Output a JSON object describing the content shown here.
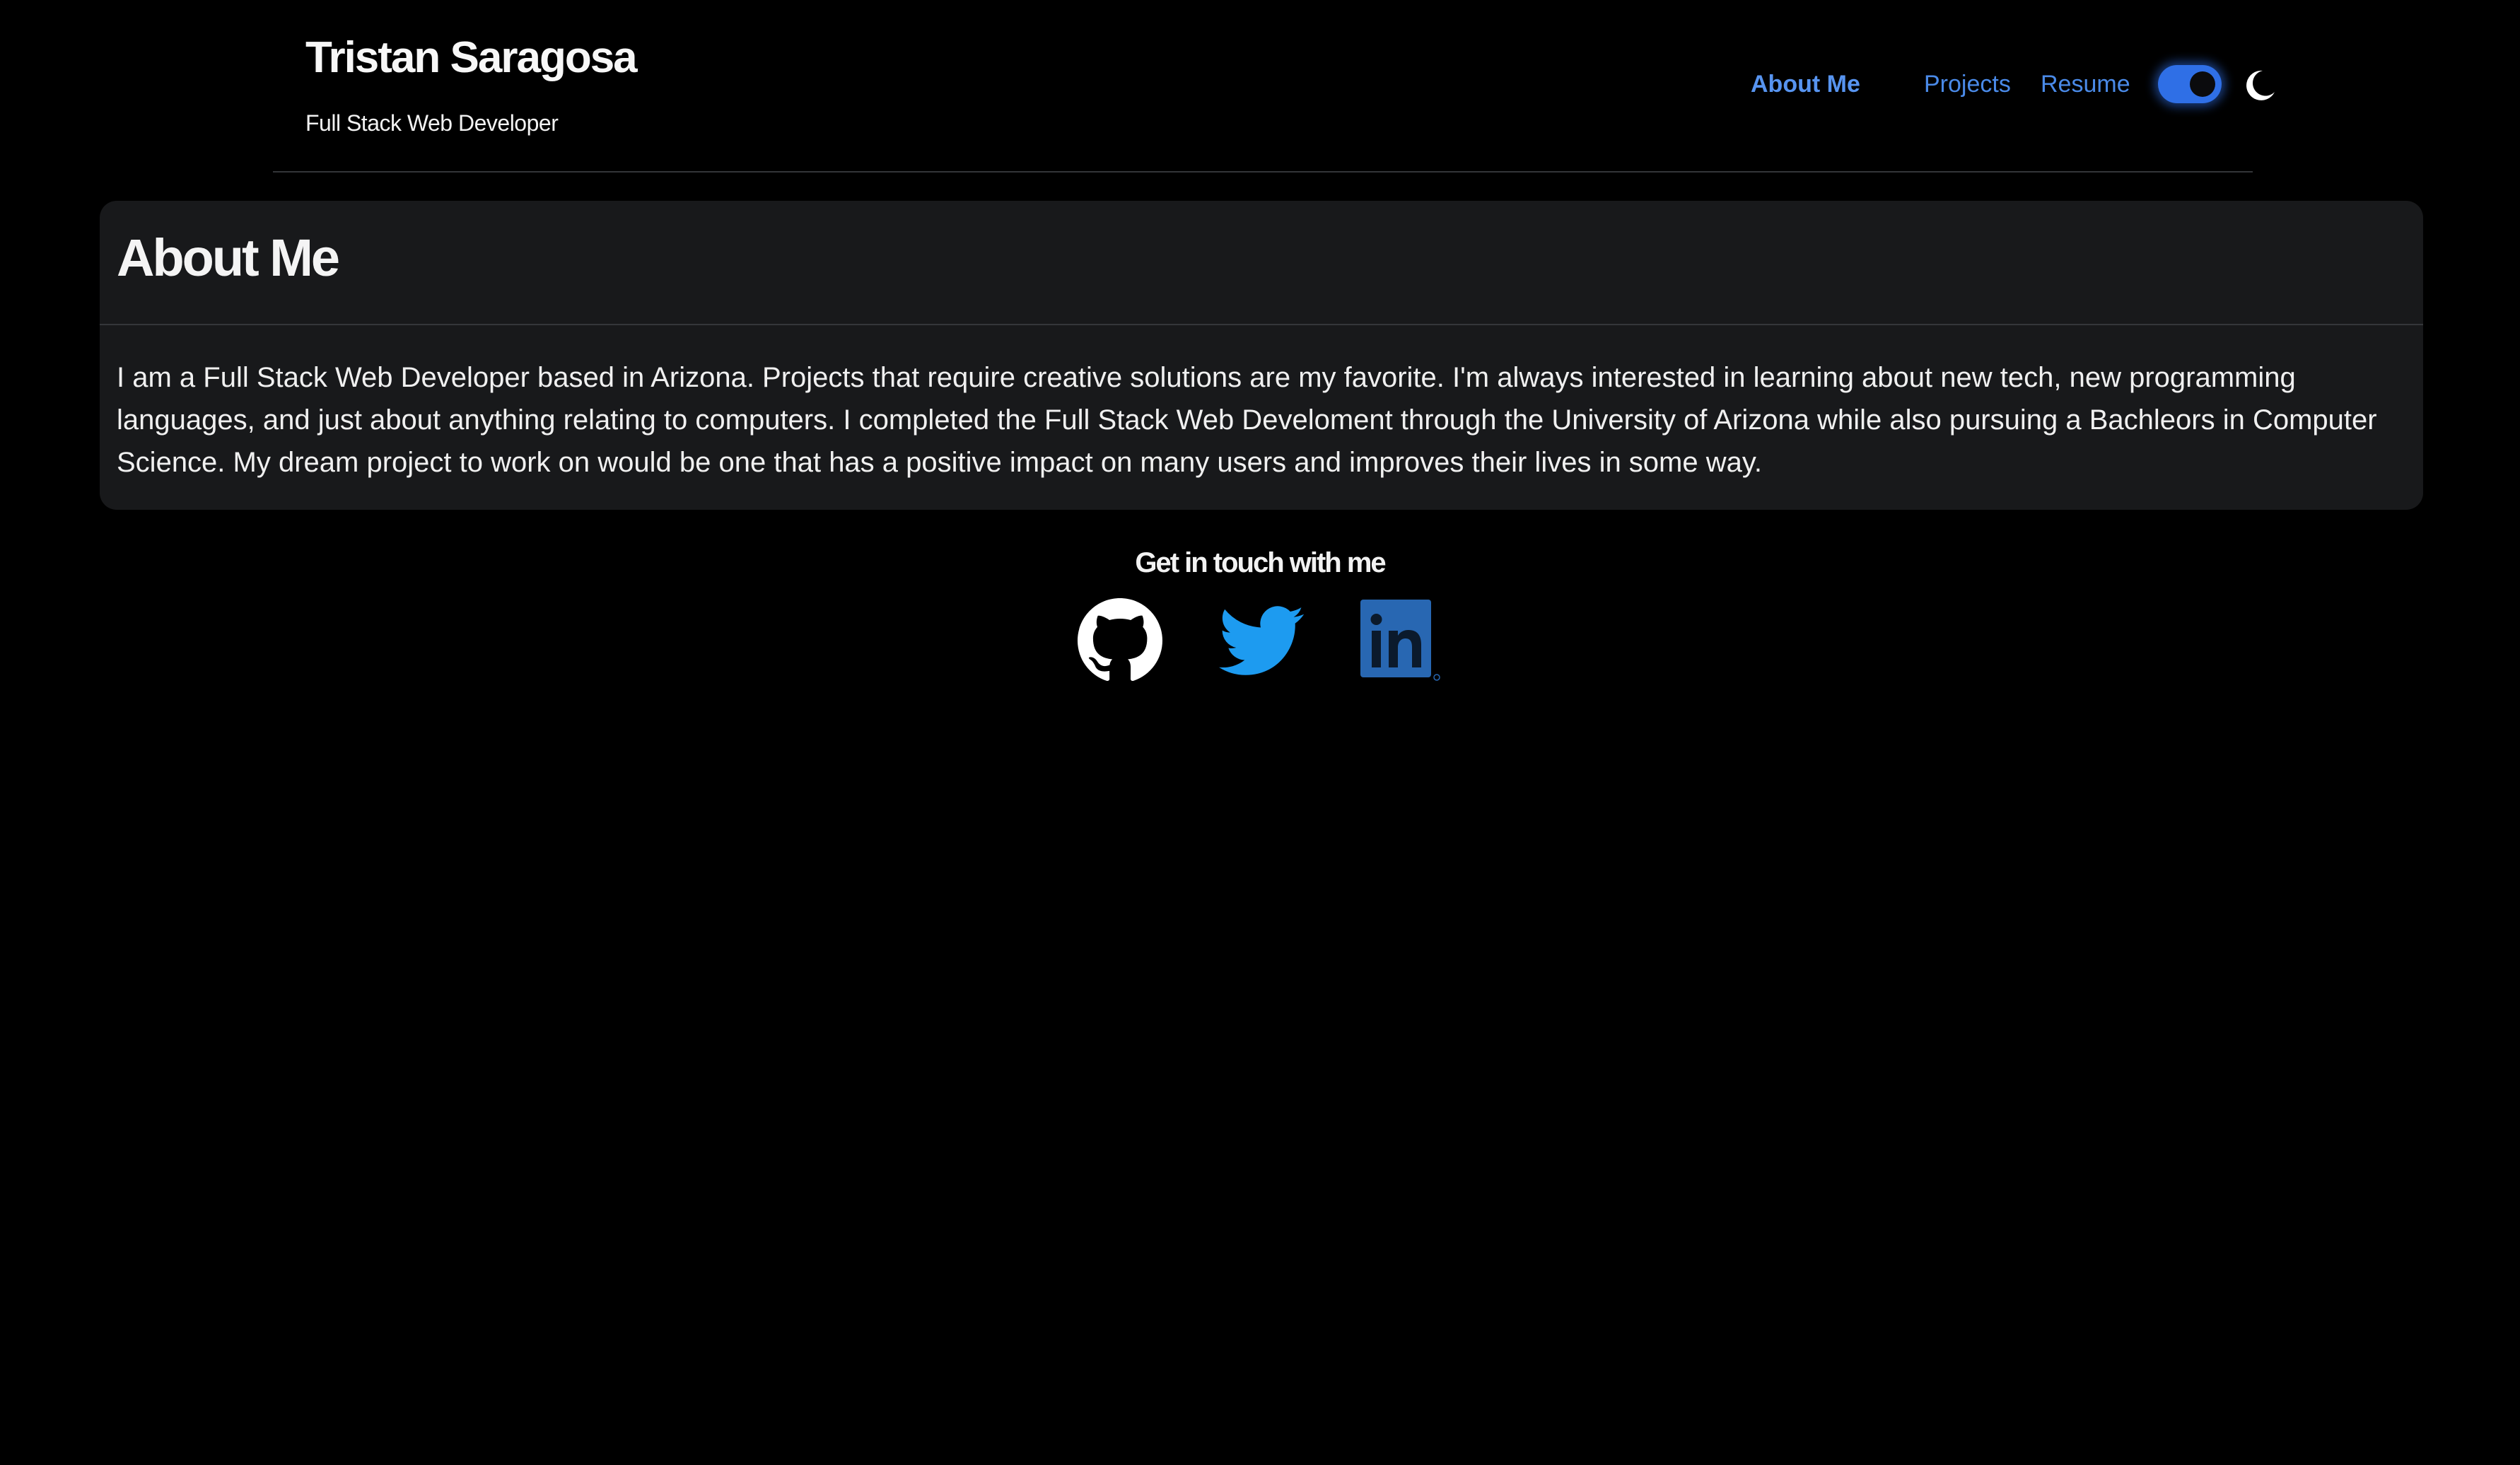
{
  "header": {
    "title": "Tristan Saragosa",
    "subtitle": "Full Stack Web Developer"
  },
  "nav": {
    "items": [
      {
        "label": "About Me",
        "active": true
      },
      {
        "label": "Projects",
        "active": false
      },
      {
        "label": "Resume",
        "active": false
      }
    ],
    "theme_toggle": {
      "state": "on",
      "icon": "moon-icon"
    }
  },
  "about": {
    "heading": "About Me",
    "body": "I am a Full Stack Web Developer based in Arizona. Projects that require creative solutions are my favorite. I'm always interested in learning about new tech, new programming languages, and just about anything relating to computers. I completed the Full Stack Web Develoment through the University of Arizona while also pursuing a Bachleors in Computer Science. My dream project to work on would be one that has a positive impact on many users and improves their lives in some way."
  },
  "contact": {
    "heading": "Get in touch with me",
    "links": [
      {
        "icon": "github-icon",
        "color": "#ffffff"
      },
      {
        "icon": "twitter-icon",
        "color": "#1d9bf0"
      },
      {
        "icon": "linkedin-icon",
        "color": "#2867b2"
      }
    ]
  },
  "colors": {
    "background": "#000000",
    "card": "#18191b",
    "link": "#4a8ae8",
    "toggle": "#2f6fe6"
  }
}
